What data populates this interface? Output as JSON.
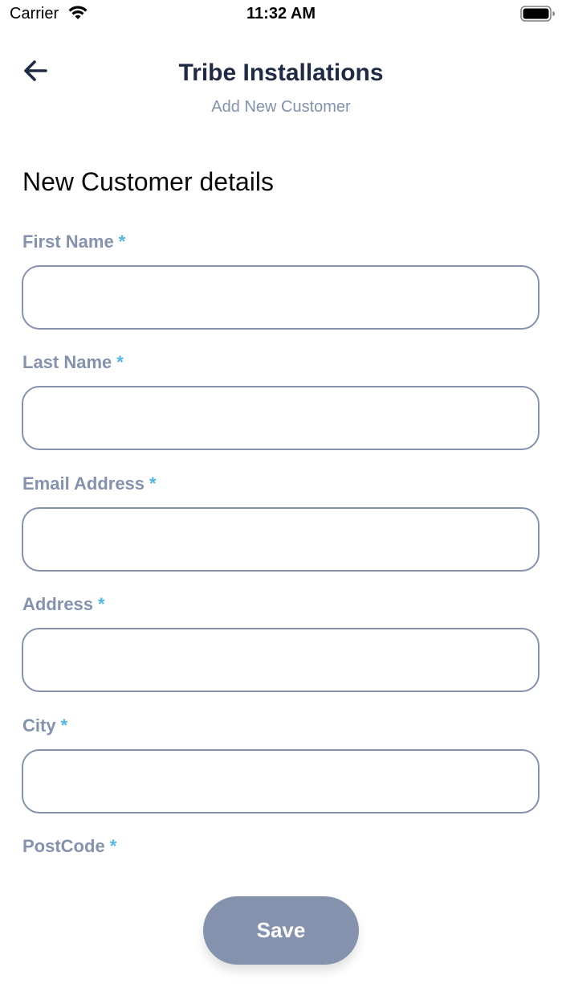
{
  "status_bar": {
    "carrier": "Carrier",
    "time": "11:32 AM",
    "icons": [
      "wifi-icon",
      "battery-icon"
    ]
  },
  "header": {
    "back_icon": "arrow-left-icon",
    "title": "Tribe Installations",
    "subtitle": "Add New Customer"
  },
  "form": {
    "section_title": "New Customer details",
    "required_marker": "*",
    "fields": [
      {
        "label": "First Name",
        "value": "",
        "placeholder": ""
      },
      {
        "label": "Last Name",
        "value": "",
        "placeholder": ""
      },
      {
        "label": "Email Address",
        "value": "",
        "placeholder": ""
      },
      {
        "label": "Address",
        "value": "",
        "placeholder": ""
      },
      {
        "label": "City",
        "value": "",
        "placeholder": ""
      },
      {
        "label": "PostCode",
        "value": "",
        "placeholder": ""
      }
    ],
    "save_label": "Save"
  },
  "colors": {
    "title": "#1f2a44",
    "label": "#8592ad",
    "required": "#4fb6e6",
    "button_bg": "#8592ad",
    "input_border": "#8592ad"
  }
}
